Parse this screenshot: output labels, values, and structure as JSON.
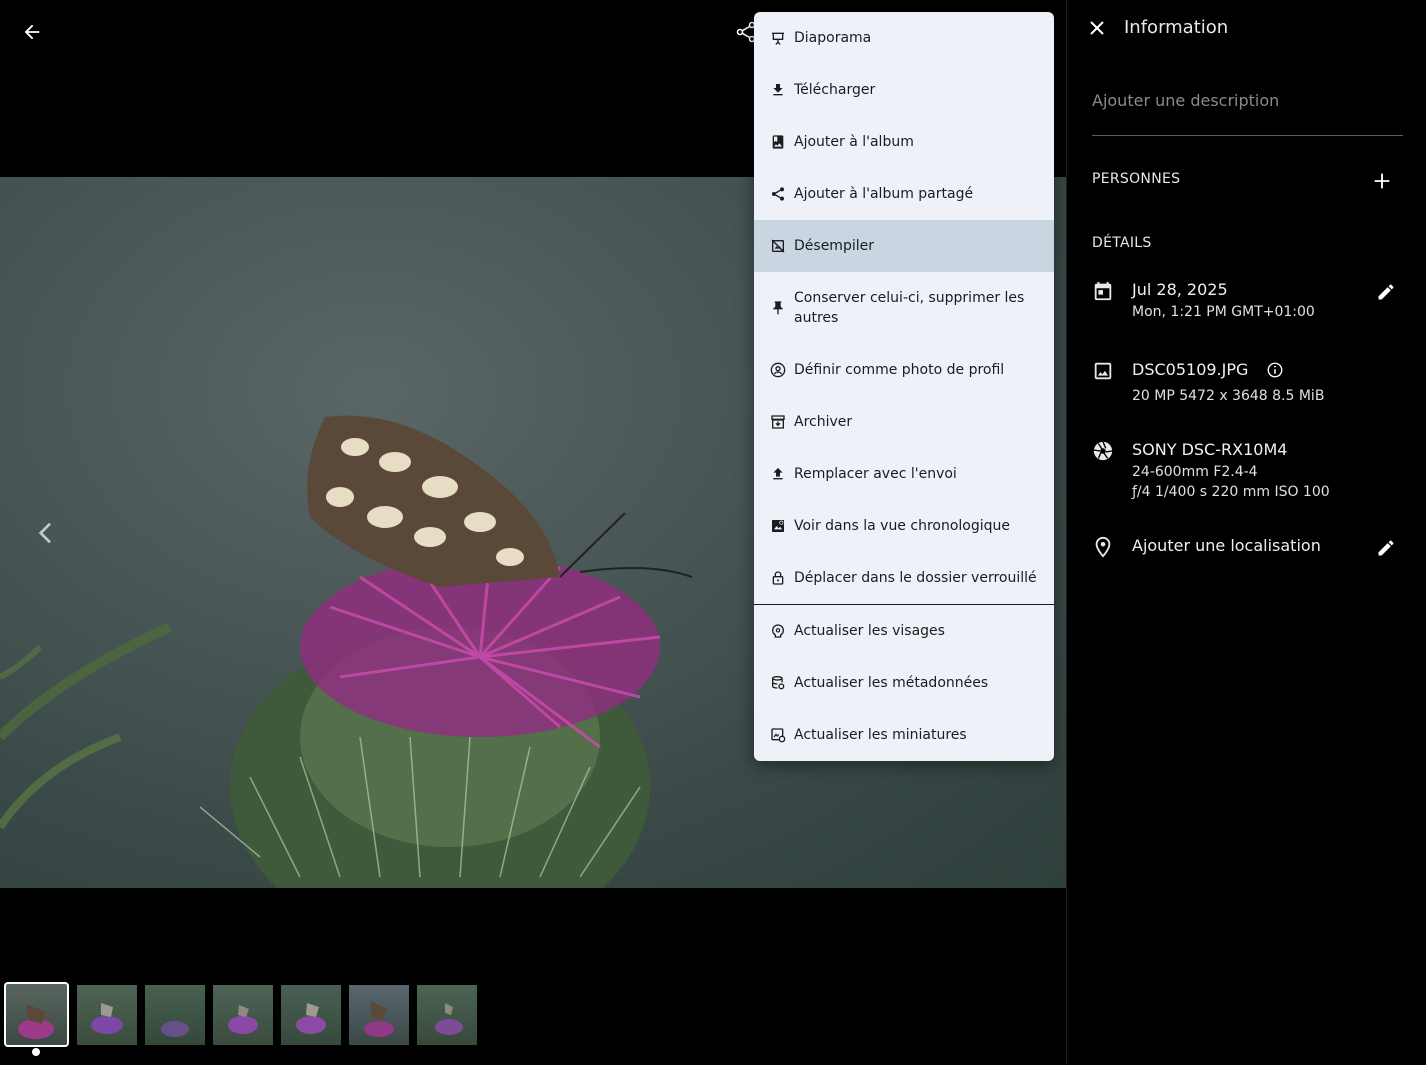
{
  "menu": {
    "items": [
      {
        "label": "Diaporama",
        "icon": "slideshow-icon"
      },
      {
        "label": "Télécharger",
        "icon": "download-icon"
      },
      {
        "label": "Ajouter à l'album",
        "icon": "album-icon"
      },
      {
        "label": "Ajouter à l'album partagé",
        "icon": "share-icon"
      },
      {
        "label": "Désempiler",
        "icon": "unstack-icon"
      },
      {
        "label": "Conserver celui-ci, supprimer les autres",
        "icon": "pin-icon"
      },
      {
        "label": "Définir comme photo de profil",
        "icon": "profile-icon"
      },
      {
        "label": "Archiver",
        "icon": "archive-icon"
      },
      {
        "label": "Remplacer avec l'envoi",
        "icon": "upload-icon"
      },
      {
        "label": "Voir dans la vue chronologique",
        "icon": "timeline-icon"
      },
      {
        "label": "Déplacer dans le dossier verrouillé",
        "icon": "lock-icon"
      },
      {
        "label": "Actualiser les visages",
        "icon": "faces-icon"
      },
      {
        "label": "Actualiser les métadonnées",
        "icon": "metadata-icon"
      },
      {
        "label": "Actualiser les miniatures",
        "icon": "thumbnails-icon"
      }
    ]
  },
  "panel": {
    "title": "Information",
    "description_placeholder": "Ajouter une description",
    "people_header": "PERSONNES",
    "details_header": "DÉTAILS",
    "date": "Jul 28, 2025",
    "datetime": "Mon, 1:21 PM GMT+01:00",
    "filename": "DSC05109.JPG",
    "file_meta": "20 MP   5472 x 3648   8.5 MiB",
    "camera": "SONY DSC-RX10M4",
    "lens": "24-600mm F2.4-4",
    "exposure": "ƒ/4   1/400 s   220 mm   ISO 100",
    "location": "Ajouter une localisation"
  },
  "colors": {
    "menu_bg": "#eef2f8",
    "menu_hover": "#cad5e2",
    "panel_bg": "#000000"
  }
}
